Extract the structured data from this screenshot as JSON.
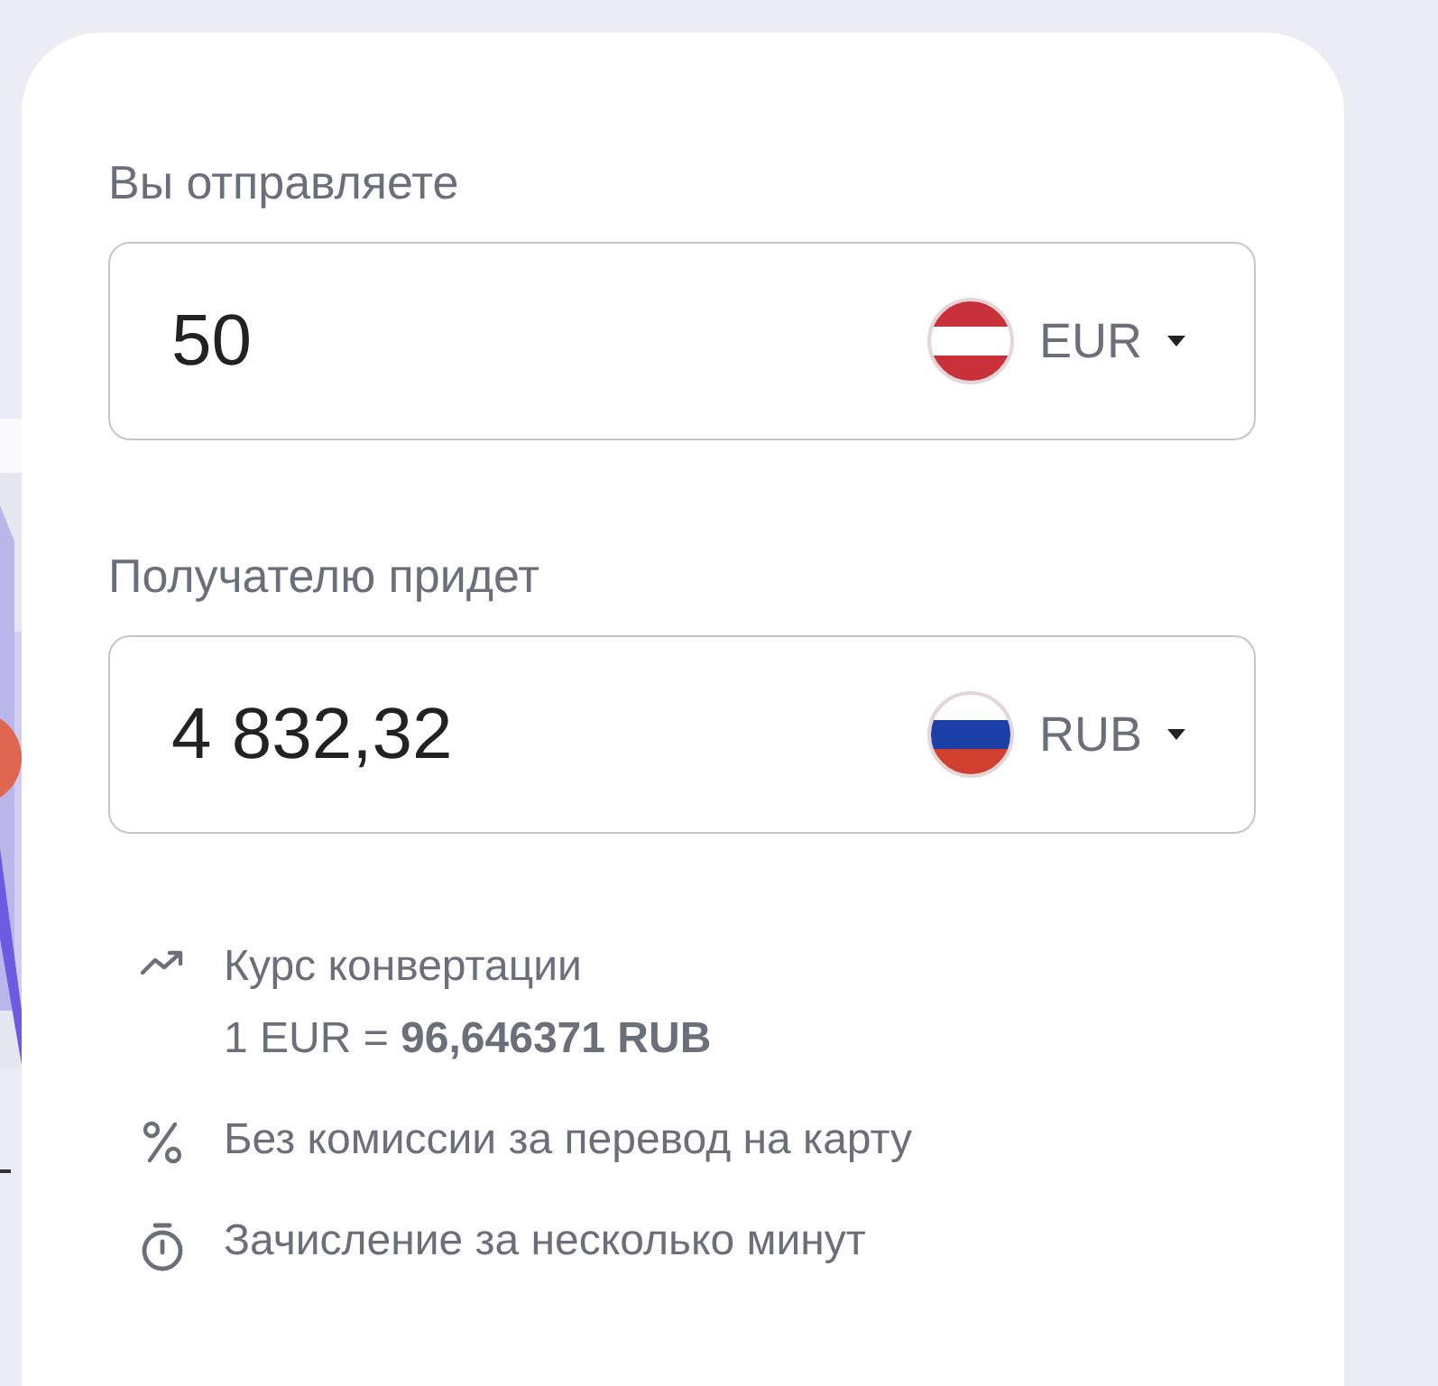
{
  "send": {
    "label": "Вы отправляете",
    "value": "50",
    "currency": "EUR",
    "flag": {
      "kind": "austria"
    }
  },
  "receive": {
    "label": "Получателю придет",
    "value": "4 832,32",
    "currency": "RUB",
    "flag": {
      "kind": "russia"
    }
  },
  "info": [
    {
      "kind": "rate",
      "title": "Курс конвертации",
      "detail": "1 EUR = **96,646371 RUB**"
    },
    {
      "kind": "fee",
      "title": "Без комиссии за перевод на карту"
    },
    {
      "kind": "time",
      "title": "Зачисление за несколько минут"
    }
  ]
}
